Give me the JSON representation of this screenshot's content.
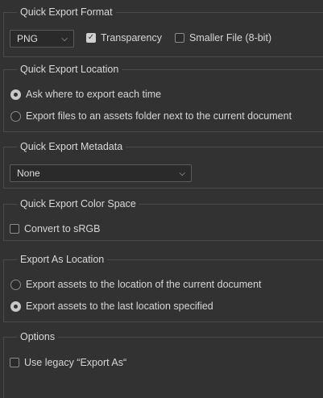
{
  "quick_export_format": {
    "title": "Quick Export Format",
    "format_value": "PNG",
    "transparency_label": "Transparency",
    "transparency_checked": true,
    "smaller_file_label": "Smaller File (8-bit)",
    "smaller_file_checked": false
  },
  "quick_export_location": {
    "title": "Quick Export Location",
    "options": [
      {
        "label": "Ask where to export each time",
        "selected": true
      },
      {
        "label": "Export files to an assets folder next to the current document",
        "selected": false
      }
    ]
  },
  "quick_export_metadata": {
    "title": "Quick Export Metadata",
    "value": "None"
  },
  "quick_export_color_space": {
    "title": "Quick Export Color Space",
    "convert_label": "Convert to sRGB",
    "convert_checked": false
  },
  "export_as_location": {
    "title": "Export As Location",
    "options": [
      {
        "label": "Export assets to the location of the current document",
        "selected": false
      },
      {
        "label": "Export assets to the last location specified",
        "selected": true
      }
    ]
  },
  "options": {
    "title": "Options",
    "legacy_label": "Use legacy “Export As“",
    "legacy_checked": false
  },
  "icons": {
    "checkmark": "✓",
    "chevron": "⌵"
  }
}
